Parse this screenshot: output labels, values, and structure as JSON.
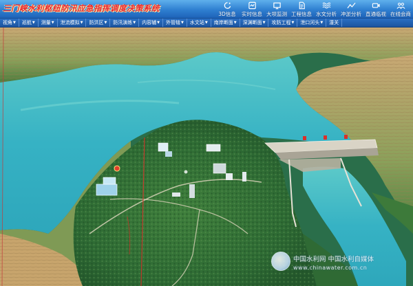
{
  "app": {
    "title": "三门峡水利枢纽防汛应急指挥调度决策系统"
  },
  "toolbar": [
    {
      "label": "3D信息",
      "icon": "refresh-3d-icon"
    },
    {
      "label": "实时信息",
      "icon": "realtime-icon"
    },
    {
      "label": "大坝监测",
      "icon": "dam-monitor-icon"
    },
    {
      "label": "工程信息",
      "icon": "document-icon"
    },
    {
      "label": "水文分析",
      "icon": "waves-icon"
    },
    {
      "label": "冲淤分析",
      "icon": "erosion-icon"
    },
    {
      "label": "直通临视",
      "icon": "camera-icon"
    },
    {
      "label": "在线会商",
      "icon": "conference-icon"
    }
  ],
  "menu": [
    {
      "label": "视角"
    },
    {
      "label": "巡航"
    },
    {
      "label": "测量"
    },
    {
      "label": "泄流模拟"
    },
    {
      "label": "防洪区"
    },
    {
      "label": "防汛演练"
    },
    {
      "label": "内容辅"
    },
    {
      "label": "外管辖"
    },
    {
      "label": "水文站"
    },
    {
      "label": "南岸断面"
    },
    {
      "label": "深渊断面"
    },
    {
      "label": "攻防工程"
    },
    {
      "label": "泄口河头"
    },
    {
      "label": "潼关"
    }
  ],
  "watermark": {
    "line1": "中国水利网  中国水利自媒体",
    "line2": "www.chinawater.com.cn"
  },
  "colors": {
    "title_text": "#e8262f",
    "toolbar_bg": "#2f7fd1",
    "water": "#37b7c6",
    "forest": "#2e6b3a"
  }
}
